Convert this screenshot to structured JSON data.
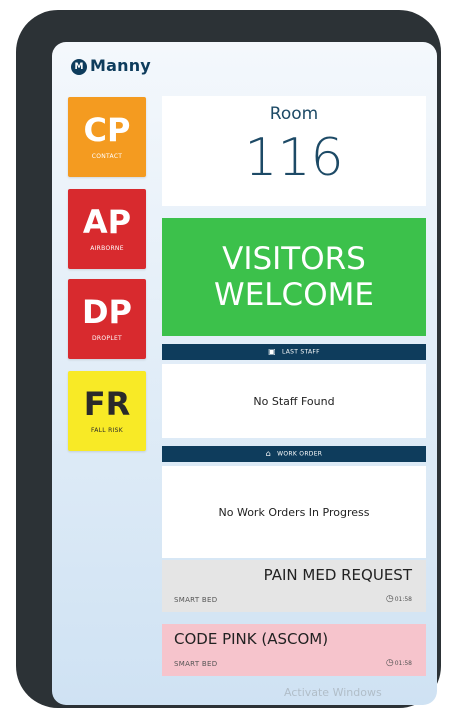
{
  "header": {
    "logo_letter": "M",
    "app_name": "Manny"
  },
  "precautions": [
    {
      "code": "CP",
      "label": "CONTACT",
      "color": "#f49b20"
    },
    {
      "code": "AP",
      "label": "AIRBORNE",
      "color": "#d82a2e"
    },
    {
      "code": "DP",
      "label": "DROPLET",
      "color": "#d82a2e"
    },
    {
      "code": "FR",
      "label": "FALL RISK",
      "color": "#f8ea26"
    }
  ],
  "room": {
    "label": "Room",
    "number": "116"
  },
  "visitors": {
    "line1": "VISITORS",
    "line2": "WELCOME",
    "color": "#3cc14b"
  },
  "last_staff": {
    "header": "LAST STAFF",
    "icon": "calendar-icon",
    "message": "No Staff Found"
  },
  "work_order": {
    "header": "WORK ORDER",
    "icon": "house-icon",
    "message": "No Work Orders In Progress"
  },
  "requests": [
    {
      "title": "PAIN MED REQUEST",
      "source": "SMART BED",
      "time": "01:58"
    },
    {
      "title": "CODE PINK (ASCOM)",
      "source": "SMART BED",
      "time": "01:58"
    }
  ],
  "watermark": "Activate Windows",
  "colors": {
    "navy": "#0e3c5c",
    "device_frame": "#2c3236"
  }
}
